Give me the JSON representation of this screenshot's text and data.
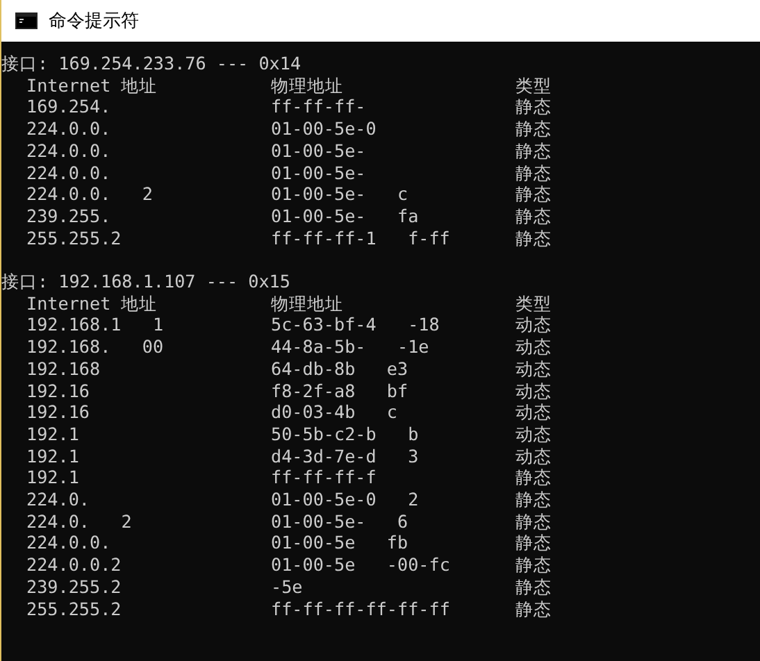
{
  "window": {
    "title": "命令提示符"
  },
  "sections": [
    {
      "header": "接口: 169.254.233.76 --- 0x14",
      "columns": [
        "Internet 地址",
        "物理地址",
        "类型"
      ],
      "rows": [
        {
          "ip": [
            "169.254."
          ],
          "mac": [
            "ff-ff-ff-"
          ],
          "type": "静态"
        },
        {
          "ip": [
            "224.0.0."
          ],
          "mac": [
            "01-00-5e-0"
          ],
          "type": "静态"
        },
        {
          "ip": [
            "224.0.0."
          ],
          "mac": [
            "01-00-5e-"
          ],
          "type": "静态"
        },
        {
          "ip": [
            "224.0.0."
          ],
          "mac": [
            "01-00-5e-"
          ],
          "type": "静态"
        },
        {
          "ip": [
            "224.0.0.",
            "2"
          ],
          "mac": [
            "01-00-5e-",
            "c"
          ],
          "type": "静态"
        },
        {
          "ip": [
            "239.255."
          ],
          "mac": [
            "01-00-5e-",
            "fa"
          ],
          "type": "静态"
        },
        {
          "ip": [
            "255.255.2"
          ],
          "mac": [
            "ff-ff-ff-1",
            "f-ff"
          ],
          "type": "静态"
        }
      ]
    },
    {
      "header": "接口: 192.168.1.107 --- 0x15",
      "columns": [
        "Internet 地址",
        "物理地址",
        "类型"
      ],
      "rows": [
        {
          "ip": [
            "192.168.1",
            "1"
          ],
          "mac": [
            "5c-63-bf-4",
            "-18"
          ],
          "type": "动态"
        },
        {
          "ip": [
            "192.168.",
            "00"
          ],
          "mac": [
            "44-8a-5b-",
            "-1e"
          ],
          "type": "动态"
        },
        {
          "ip": [
            "192.168"
          ],
          "mac": [
            "64-db-8b",
            "e3"
          ],
          "type": "动态"
        },
        {
          "ip": [
            "192.16"
          ],
          "mac": [
            "f8-2f-a8",
            "bf"
          ],
          "type": "动态"
        },
        {
          "ip": [
            "192.16"
          ],
          "mac": [
            "d0-03-4b",
            "c"
          ],
          "type": "动态"
        },
        {
          "ip": [
            "192.1"
          ],
          "mac": [
            "50-5b-c2-b",
            "b"
          ],
          "type": "动态"
        },
        {
          "ip": [
            "192.1"
          ],
          "mac": [
            "d4-3d-7e-d",
            "3"
          ],
          "type": "动态"
        },
        {
          "ip": [
            "192.1"
          ],
          "mac": [
            "ff-ff-ff-f"
          ],
          "type": "静态"
        },
        {
          "ip": [
            "224.0."
          ],
          "mac": [
            "01-00-5e-0",
            "2"
          ],
          "type": "静态"
        },
        {
          "ip": [
            "224.0.",
            "2"
          ],
          "mac": [
            "01-00-5e-",
            "6"
          ],
          "type": "静态"
        },
        {
          "ip": [
            "224.0.0."
          ],
          "mac": [
            "01-00-5e",
            "fb"
          ],
          "type": "静态"
        },
        {
          "ip": [
            "224.0.0.2"
          ],
          "mac": [
            "01-00-5e",
            "-00-fc"
          ],
          "type": "静态"
        },
        {
          "ip": [
            "239.255.2"
          ],
          "mac": [
            "-5e"
          ],
          "type": "静态"
        },
        {
          "ip": [
            "255.255.2"
          ],
          "mac": [
            "ff-ff-ff-ff-ff-ff"
          ],
          "type": "静态"
        }
      ]
    }
  ]
}
